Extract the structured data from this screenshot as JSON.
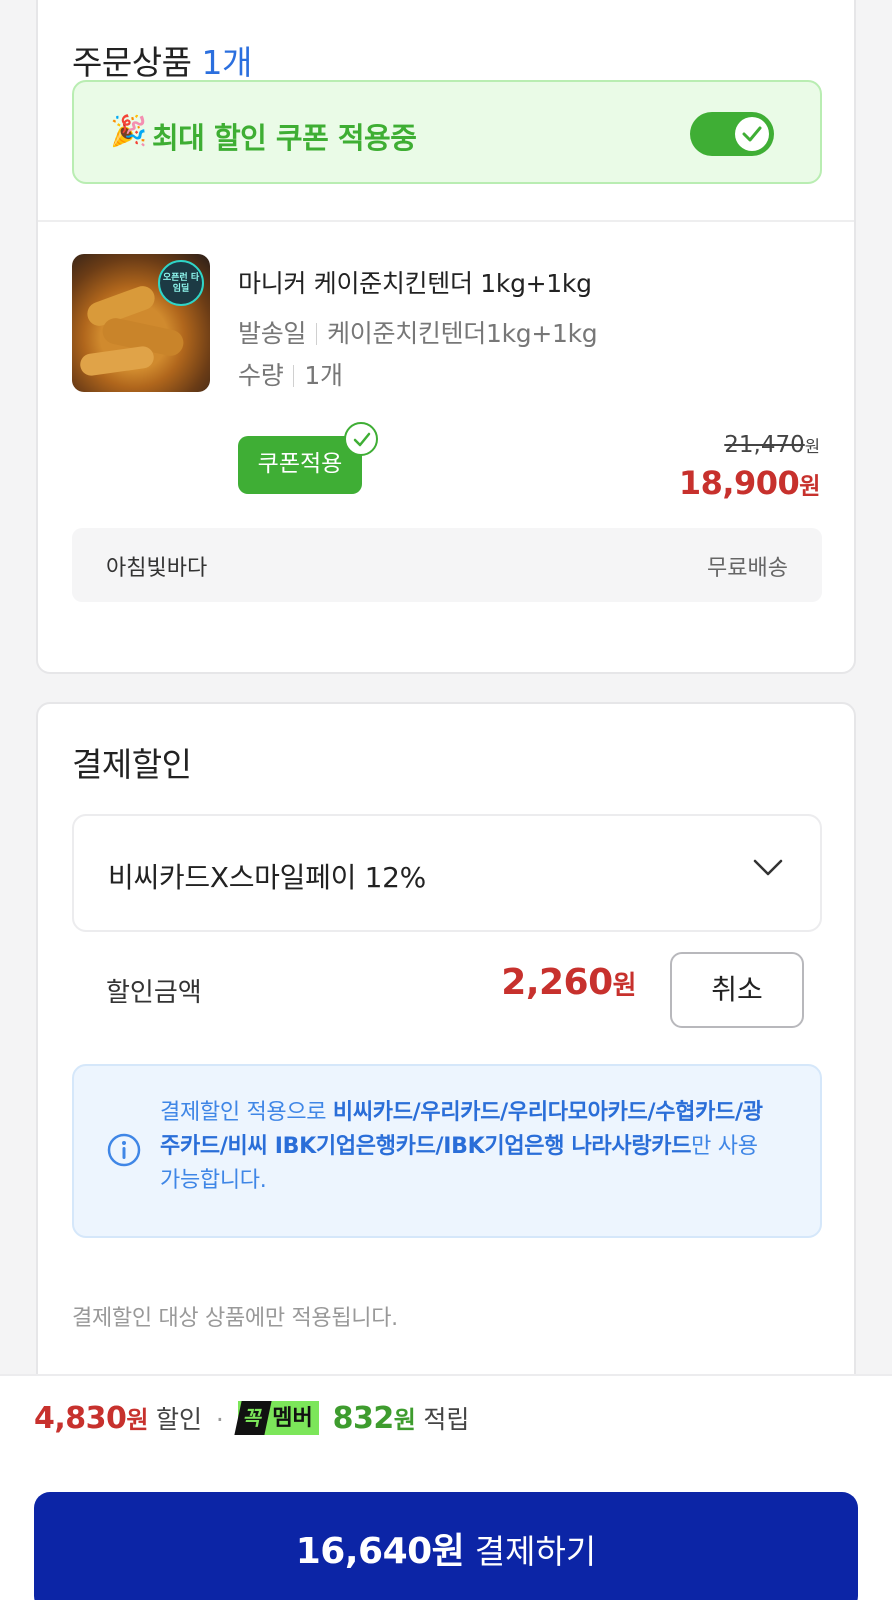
{
  "order": {
    "title": "주문상품",
    "count": "1개",
    "coupon_banner": "최대 할인 쿠폰 적용중",
    "coupon_toggle_on": true,
    "product": {
      "name": "마니커 케이준치킨텐더 1kg+1kg",
      "option_label": "발송일",
      "option_value": "케이준치킨텐더1kg+1kg",
      "qty_label": "수량",
      "qty_value": "1개",
      "coupon_tag": "쿠폰적용",
      "original_price": "21,470",
      "sale_price": "18,900",
      "won": "원",
      "thumb_badge": "오픈런 타임딜"
    },
    "seller": "아침빛바다",
    "shipping": "무료배송"
  },
  "payment_discount": {
    "title": "결제할인",
    "selected_option": "비씨카드X스마일페이 12%",
    "amount_label": "할인금액",
    "amount": "2,260",
    "won": "원",
    "cancel_label": "취소",
    "info_prefix": "결제할인 적용으로 ",
    "info_cards": "비씨카드/우리카드/우리다모아카드/수협카드/광주카드/비씨 IBK기업은행카드/IBK기업은행 나라사랑카드",
    "info_suffix": "만 사용 가능합니다.",
    "footnote": "결제할인 대상 상품에만 적용됩니다."
  },
  "bottom": {
    "discount_total": "4,830",
    "won": "원",
    "discount_word": "할인",
    "dot": "·",
    "badge_kk": "꼭",
    "badge_member": "멤버",
    "points": "832",
    "points_word": "적립",
    "pay_amount": "16,640원",
    "pay_label": "결제하기"
  },
  "colors": {
    "accent_blue": "#2b6fde",
    "coupon_green": "#3fae35",
    "price_red": "#c7312d",
    "pay_button": "#0c25a6"
  }
}
